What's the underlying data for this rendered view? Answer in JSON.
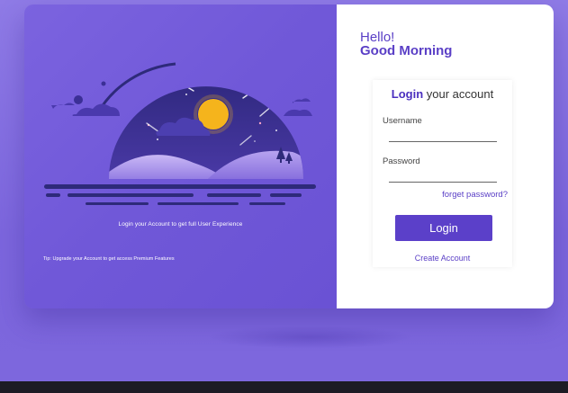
{
  "greeting": {
    "hello": "Hello!",
    "time_of_day": "Good Morning"
  },
  "login_box": {
    "title_bold": "Login",
    "title_rest": " your account",
    "username_label": "Username",
    "password_label": "Password",
    "forgot_password": "forget password?",
    "login_button": "Login",
    "create_account": "Create Account"
  },
  "left_panel": {
    "tagline": "Login your Account to get full User Experience",
    "tip": "Tip: Upgrade your Account to get access Premium Features"
  },
  "colors": {
    "accent": "#5b40c9",
    "panel_purple": "#7058d8",
    "moon": "#f5b41c",
    "night_sky": "#2e2a7a"
  }
}
